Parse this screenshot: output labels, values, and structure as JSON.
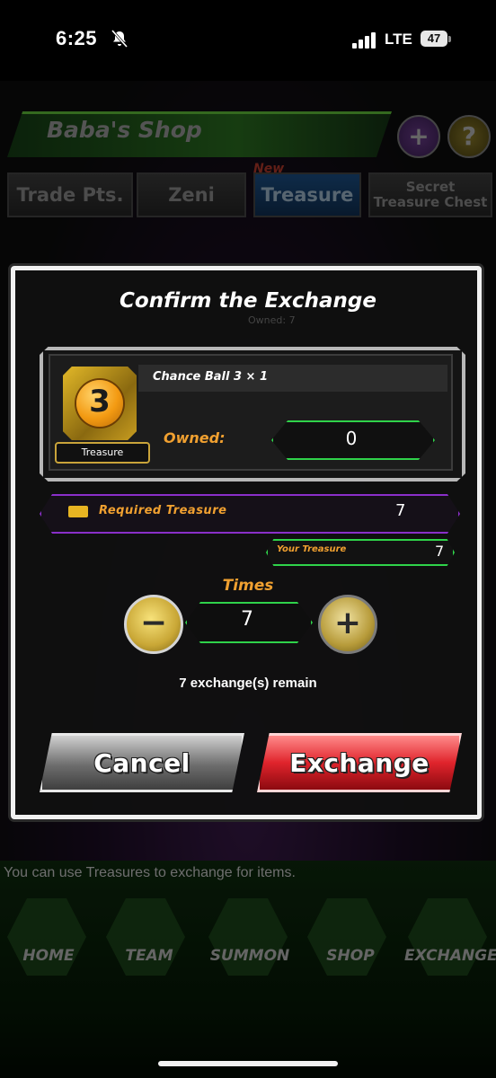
{
  "status_bar": {
    "time": "6:25",
    "carrier": "LTE",
    "battery": "47"
  },
  "shop": {
    "title": "Baba's Shop"
  },
  "tabs": [
    {
      "label": "Trade Pts."
    },
    {
      "label": "Zeni"
    },
    {
      "label": "Treasure",
      "badge": "New"
    },
    {
      "label": "Secret\nTreasure Chest"
    }
  ],
  "dialog": {
    "title": "Confirm the Exchange",
    "owned_dim": "Owned: 7",
    "item": {
      "name": "Chance Ball 3 × 1",
      "icon_number": "3",
      "tag": "Treasure",
      "owned_label": "Owned:",
      "owned_value": "0"
    },
    "required": {
      "label": "Required Treasure",
      "value": "7"
    },
    "your_treasure": {
      "label": "Your Treasure",
      "value": "7"
    },
    "times": {
      "label": "Times",
      "value": "7"
    },
    "remaining": "7 exchange(s) remain",
    "cancel_label": "Cancel",
    "exchange_label": "Exchange"
  },
  "bottom": {
    "hint": "You can use Treasures to exchange for items.",
    "nav": [
      "HOME",
      "TEAM",
      "SUMMON",
      "SHOP",
      "EXCHANGE"
    ]
  },
  "colors": {
    "accent_green": "#2fd24a",
    "accent_orange": "#f0a030",
    "accent_purple": "#8a2fc9",
    "exchange_red": "#e0242c"
  }
}
